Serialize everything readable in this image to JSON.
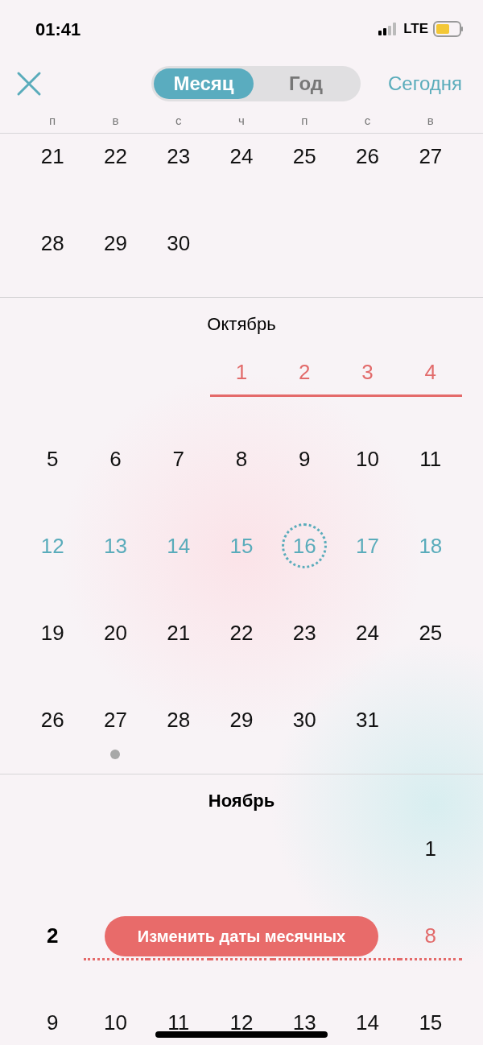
{
  "status_bar": {
    "time": "01:41",
    "network": "LTE"
  },
  "header": {
    "segments": [
      {
        "label": "Месяц",
        "selected": true
      },
      {
        "label": "Год",
        "selected": false
      }
    ],
    "today_link": "Сегодня"
  },
  "weekdays": [
    "п",
    "в",
    "с",
    "ч",
    "п",
    "с",
    "в"
  ],
  "months": [
    {
      "weeks": [
        [
          {
            "day": "21",
            "kind": "normal",
            "note": false
          },
          {
            "day": "22",
            "kind": "normal",
            "note": false
          },
          {
            "day": "23",
            "kind": "normal",
            "note": false
          },
          {
            "day": "24",
            "kind": "normal",
            "note": false
          },
          {
            "day": "25",
            "kind": "normal",
            "note": false
          },
          {
            "day": "26",
            "kind": "normal",
            "note": false
          },
          {
            "day": "27",
            "kind": "normal",
            "note": false
          }
        ],
        [
          {
            "day": "28",
            "kind": "normal",
            "note": false
          },
          {
            "day": "29",
            "kind": "normal",
            "note": false
          },
          {
            "day": "30",
            "kind": "normal",
            "note": false
          },
          {
            "kind": "blank"
          },
          {
            "kind": "blank"
          },
          {
            "kind": "blank"
          },
          {
            "kind": "blank"
          }
        ]
      ]
    },
    {
      "title": "Октябрь",
      "weeks": [
        [
          {
            "kind": "blank"
          },
          {
            "kind": "blank"
          },
          {
            "kind": "blank"
          },
          {
            "day": "1",
            "kind": "period",
            "note": false
          },
          {
            "day": "2",
            "kind": "period",
            "note": false
          },
          {
            "day": "3",
            "kind": "period",
            "note": false
          },
          {
            "day": "4",
            "kind": "period",
            "note": false
          }
        ],
        [
          {
            "day": "5",
            "kind": "normal",
            "note": false
          },
          {
            "day": "6",
            "kind": "normal",
            "note": false
          },
          {
            "day": "7",
            "kind": "normal",
            "note": false
          },
          {
            "day": "8",
            "kind": "normal",
            "note": false
          },
          {
            "day": "9",
            "kind": "normal",
            "note": false
          },
          {
            "day": "10",
            "kind": "normal",
            "note": false
          },
          {
            "day": "11",
            "kind": "normal",
            "note": false
          }
        ],
        [
          {
            "day": "12",
            "kind": "fertile",
            "note": false
          },
          {
            "day": "13",
            "kind": "fertile",
            "note": false
          },
          {
            "day": "14",
            "kind": "fertile",
            "note": false
          },
          {
            "day": "15",
            "kind": "fertile",
            "note": false
          },
          {
            "day": "16",
            "kind": "ovulation",
            "note": false
          },
          {
            "day": "17",
            "kind": "fertile",
            "note": false
          },
          {
            "day": "18",
            "kind": "fertile",
            "note": false
          }
        ],
        [
          {
            "day": "19",
            "kind": "normal",
            "note": false
          },
          {
            "day": "20",
            "kind": "normal",
            "note": false
          },
          {
            "day": "21",
            "kind": "normal",
            "note": false
          },
          {
            "day": "22",
            "kind": "normal",
            "note": false
          },
          {
            "day": "23",
            "kind": "normal",
            "note": false
          },
          {
            "day": "24",
            "kind": "normal",
            "note": false
          },
          {
            "day": "25",
            "kind": "normal",
            "note": false
          }
        ],
        [
          {
            "day": "26",
            "kind": "normal",
            "note": false
          },
          {
            "day": "27",
            "kind": "normal",
            "note": true
          },
          {
            "day": "28",
            "kind": "normal",
            "note": false
          },
          {
            "day": "29",
            "kind": "normal",
            "note": false
          },
          {
            "day": "30",
            "kind": "normal",
            "note": false
          },
          {
            "day": "31",
            "kind": "normal",
            "note": false
          },
          {
            "kind": "blank"
          }
        ]
      ]
    },
    {
      "title": "Ноябрь",
      "current": true,
      "weeks": [
        [
          {
            "kind": "blank"
          },
          {
            "kind": "blank"
          },
          {
            "kind": "blank"
          },
          {
            "kind": "blank"
          },
          {
            "kind": "blank"
          },
          {
            "kind": "blank"
          },
          {
            "day": "1",
            "kind": "normal",
            "note": false
          }
        ],
        [
          {
            "day": "2",
            "kind": "today",
            "note": false
          },
          {
            "kind": "predicted"
          },
          {
            "kind": "predicted"
          },
          {
            "kind": "predicted"
          },
          {
            "kind": "predicted"
          },
          {
            "kind": "predicted"
          },
          {
            "day": "8",
            "kind": "predicted",
            "note": false
          }
        ],
        [
          {
            "day": "9",
            "kind": "normal"
          },
          {
            "day": "10",
            "kind": "normal"
          },
          {
            "day": "11",
            "kind": "normal"
          },
          {
            "day": "12",
            "kind": "normal"
          },
          {
            "day": "13",
            "kind": "normal"
          },
          {
            "day": "14",
            "kind": "normal"
          },
          {
            "day": "15",
            "kind": "normal"
          }
        ]
      ]
    }
  ],
  "action_button": "Изменить даты месячных"
}
